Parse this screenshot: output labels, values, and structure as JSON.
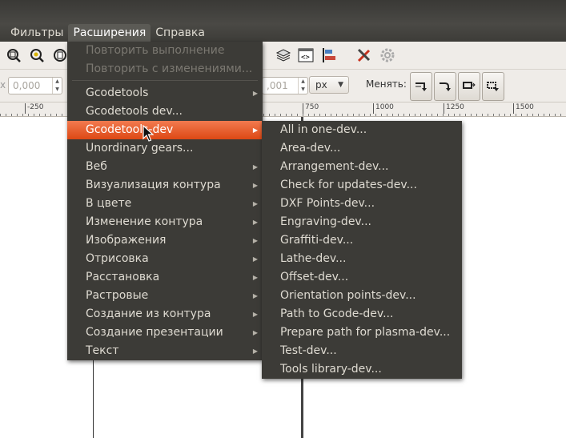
{
  "menubar": {
    "items": [
      "Фильтры",
      "Расширения",
      "Справка"
    ]
  },
  "toolbar": {
    "spin_left_value": "0,000",
    "spin_right_value": ",001",
    "unit_value": "px",
    "change_label": "Менять:"
  },
  "ruler": {
    "ticks": [
      "-250",
      "750",
      "1000",
      "1250",
      "1500"
    ]
  },
  "extensions_menu": {
    "items": [
      {
        "label": "Повторить выполнение",
        "disabled": true,
        "submenu": false
      },
      {
        "label": "Повторить с изменениями...",
        "disabled": true,
        "submenu": false
      },
      {
        "label": "Gcodetools",
        "disabled": false,
        "submenu": true
      },
      {
        "label": "Gcodetools dev...",
        "disabled": false,
        "submenu": false
      },
      {
        "label": "Gcodetools-dev",
        "disabled": false,
        "submenu": true,
        "highlighted": true
      },
      {
        "label": "Unordinary gears...",
        "disabled": false,
        "submenu": false
      },
      {
        "label": "Веб",
        "disabled": false,
        "submenu": true
      },
      {
        "label": "Визуализация контура",
        "disabled": false,
        "submenu": true
      },
      {
        "label": "В цвете",
        "disabled": false,
        "submenu": true
      },
      {
        "label": "Изменение контура",
        "disabled": false,
        "submenu": true
      },
      {
        "label": "Изображения",
        "disabled": false,
        "submenu": true
      },
      {
        "label": "Отрисовка",
        "disabled": false,
        "submenu": true
      },
      {
        "label": "Расстановка",
        "disabled": false,
        "submenu": true
      },
      {
        "label": "Растровые",
        "disabled": false,
        "submenu": true
      },
      {
        "label": "Создание из контура",
        "disabled": false,
        "submenu": true
      },
      {
        "label": "Создание презентации",
        "disabled": false,
        "submenu": true
      },
      {
        "label": "Текст",
        "disabled": false,
        "submenu": true
      }
    ]
  },
  "gcodetools_dev_submenu": {
    "items": [
      "All in one-dev...",
      "Area-dev...",
      "Arrangement-dev...",
      "Check for updates-dev...",
      "DXF Points-dev...",
      "Engraving-dev...",
      "Graffiti-dev...",
      "Lathe-dev...",
      "Offset-dev...",
      "Orientation points-dev...",
      "Path to Gcode-dev...",
      "Prepare path for plasma-dev...",
      "Test-dev...",
      "Tools library-dev..."
    ]
  },
  "colors": {
    "menu_bg": "#3c3b37",
    "highlight": "#e8592a",
    "menu_text": "#dfdbd2"
  }
}
